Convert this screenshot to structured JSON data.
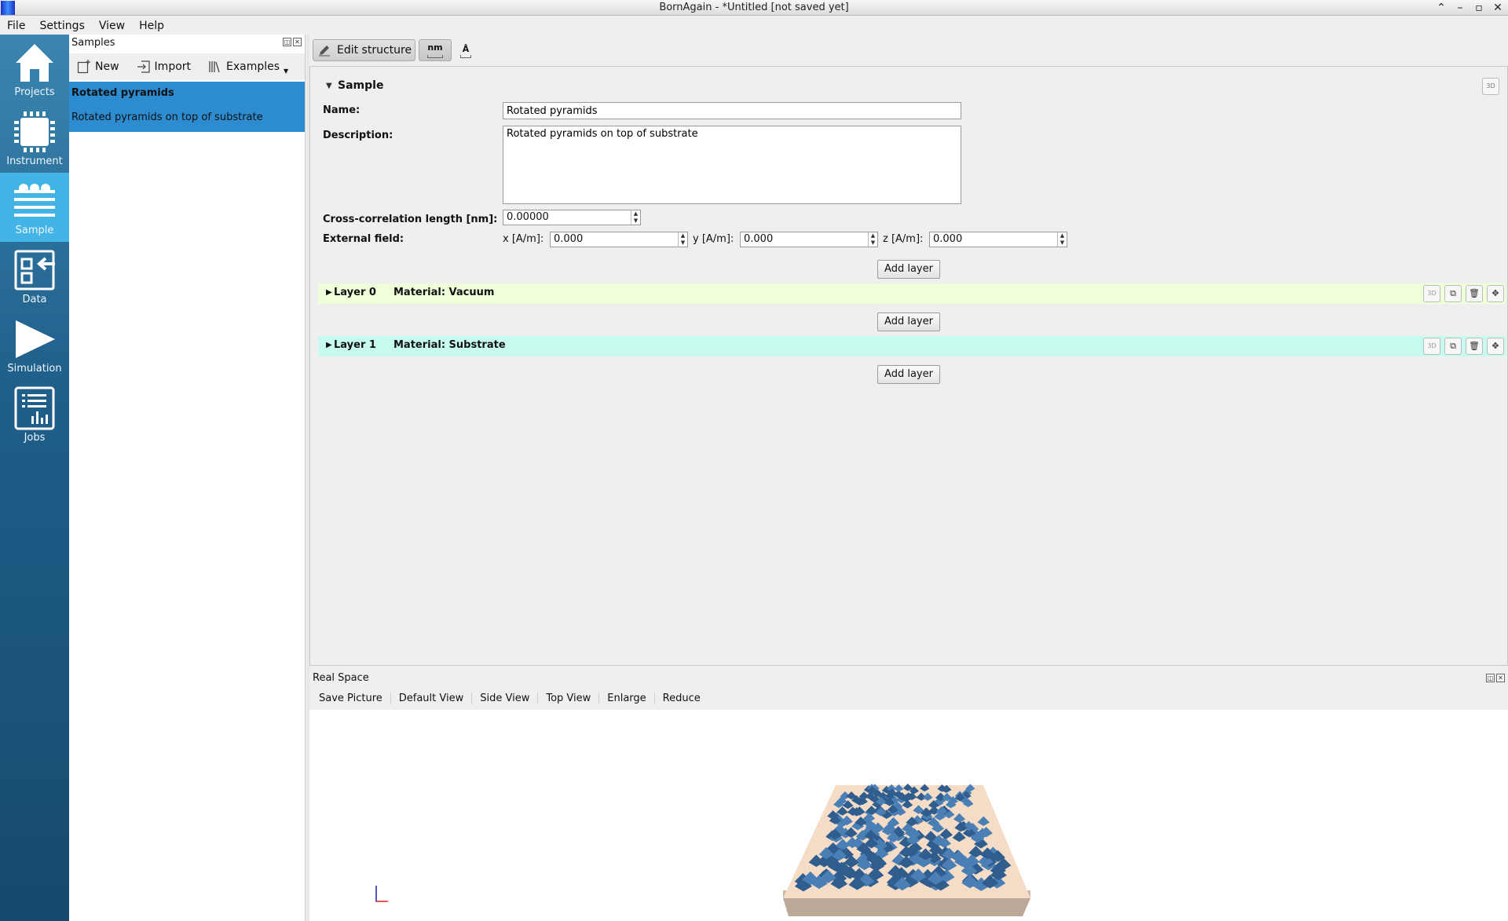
{
  "window": {
    "title": "BornAgain - *Untitled [not saved yet]"
  },
  "menu": [
    "File",
    "Settings",
    "View",
    "Help"
  ],
  "nav": {
    "items": [
      {
        "label": "Projects",
        "icon": "house-icon",
        "active": false
      },
      {
        "label": "Instrument",
        "icon": "chip-icon",
        "active": false
      },
      {
        "label": "Sample",
        "icon": "layers-icon",
        "active": true
      },
      {
        "label": "Data",
        "icon": "import-data-icon",
        "active": false
      },
      {
        "label": "Simulation",
        "icon": "play-icon",
        "active": false
      },
      {
        "label": "Jobs",
        "icon": "jobs-chart-icon",
        "active": false
      }
    ]
  },
  "samples_panel": {
    "title": "Samples",
    "toolbar": {
      "new_label": "New",
      "import_label": "Import",
      "examples_label": "Examples"
    },
    "items": [
      {
        "name": "Rotated pyramids",
        "description": "Rotated pyramids on top of substrate",
        "selected": true
      }
    ]
  },
  "editor_toolbar": {
    "edit_label": "Edit structure",
    "unit_label": "nm",
    "angstrom_label": "Å"
  },
  "sample_form": {
    "section_title": "Sample",
    "name_label": "Name:",
    "name_value": "Rotated pyramids",
    "description_label": "Description:",
    "description_value": "Rotated pyramids on top of substrate",
    "cross_corr_label": "Cross-correlation length [nm]:",
    "cross_corr_value": "0.00000",
    "external_field_label": "External field:",
    "x_label": "x [A/m]:",
    "x_value": "0.000",
    "y_label": "y [A/m]:",
    "y_value": "0.000",
    "z_label": "z [A/m]:",
    "z_value": "0.000",
    "add_layer_label": "Add layer"
  },
  "layers": [
    {
      "name": "Layer 0",
      "material": "Material: Vacuum",
      "color": "#eeffd9"
    },
    {
      "name": "Layer 1",
      "material": "Material: Substrate",
      "color": "#c8fbef"
    }
  ],
  "real_space": {
    "title": "Real Space",
    "toolbar": [
      "Save Picture",
      "Default View",
      "Side View",
      "Top View",
      "Enlarge",
      "Reduce"
    ]
  },
  "colors": {
    "nav_active": "#42b4e6",
    "selection": "#2d8ccf",
    "pyramid": "#4a7fb5",
    "substrate": "#f5dcc6"
  }
}
